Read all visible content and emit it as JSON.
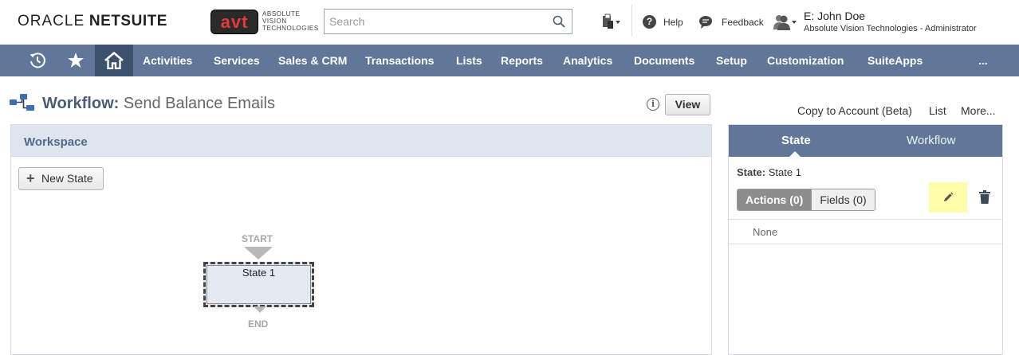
{
  "header": {
    "brand_oracle": "ORACLE",
    "brand_netsuite": "NETSUITE",
    "company_logo_text": "avt",
    "company_logo_sub": [
      "ABSOLUTE",
      "VISION",
      "TECHNOLOGIES"
    ],
    "search_placeholder": "Search",
    "help_label": "Help",
    "feedback_label": "Feedback",
    "user_name": "E: John Doe",
    "user_role": "Absolute Vision Technologies - Administrator"
  },
  "nav": {
    "items": [
      "Activities",
      "Services",
      "Sales & CRM",
      "Transactions",
      "Lists",
      "Reports",
      "Analytics",
      "Documents",
      "Setup",
      "Customization",
      "SuiteApps",
      "..."
    ]
  },
  "page": {
    "title_label": "Workflow:",
    "title_value": "Send Balance Emails",
    "info_symbol": "i",
    "view_button": "View",
    "links": [
      "Copy to Account (Beta)",
      "List",
      "More..."
    ]
  },
  "workspace": {
    "title": "Workspace",
    "new_state_button": "New State",
    "start_label": "START",
    "end_label": "END",
    "state_node_label": "State 1"
  },
  "state_panel": {
    "tabs": [
      "State",
      "Workflow"
    ],
    "active_tab": "State",
    "state_key": "State:",
    "state_value": "State 1",
    "actions_tab": "Actions (0)",
    "fields_tab": "Fields (0)",
    "empty_text": "None"
  },
  "colors": {
    "nav_bg": "#607799",
    "nav_home_bg": "#3c5070",
    "workspace_header_bg": "#e0e6ef",
    "edit_highlight": "#fffcaa"
  }
}
